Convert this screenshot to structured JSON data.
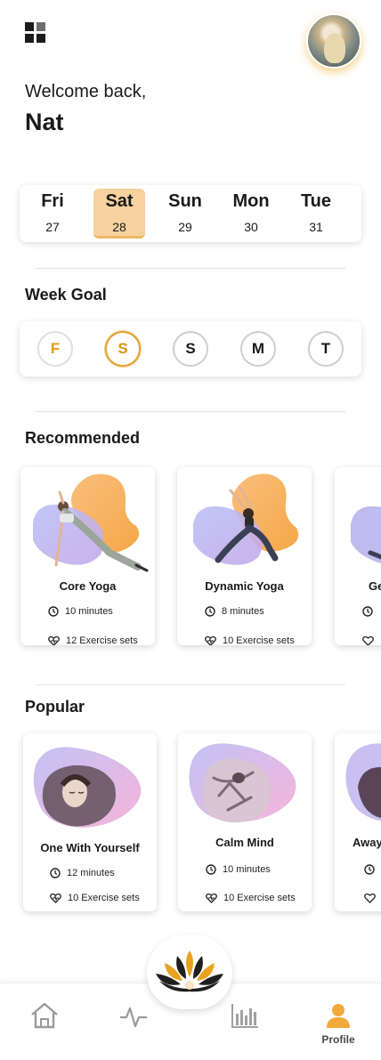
{
  "header": {
    "menu_icon": "grid-menu-icon",
    "avatar_icon": "user-avatar"
  },
  "greeting": {
    "welcome": "Welcome back,",
    "name": "Nat"
  },
  "calendar": {
    "days": [
      {
        "name": "Fri",
        "date": "27",
        "active": false
      },
      {
        "name": "Sat",
        "date": "28",
        "active": true
      },
      {
        "name": "Sun",
        "date": "29",
        "active": false
      },
      {
        "name": "Mon",
        "date": "30",
        "active": false
      },
      {
        "name": "Tue",
        "date": "31",
        "active": false
      }
    ]
  },
  "week_goal": {
    "title": "Week Goal",
    "days": [
      {
        "letter": "F",
        "state": "done"
      },
      {
        "letter": "S",
        "state": "today"
      },
      {
        "letter": "S",
        "state": "upcoming"
      },
      {
        "letter": "M",
        "state": "upcoming"
      },
      {
        "letter": "T",
        "state": "upcoming"
      }
    ]
  },
  "recommended": {
    "title": "Recommended",
    "cards": [
      {
        "title": "Core Yoga",
        "duration": "10 minutes",
        "sets": "12 Exercise sets"
      },
      {
        "title": "Dynamic Yoga",
        "duration": "8 minutes",
        "sets": "10 Exercise sets"
      },
      {
        "title": "Ge",
        "duration": "",
        "sets": ""
      }
    ]
  },
  "popular": {
    "title": "Popular",
    "cards": [
      {
        "title": "One With Yourself",
        "duration": "12 minutes",
        "sets": "10 Exercise sets"
      },
      {
        "title": "Calm Mind",
        "duration": "10 minutes",
        "sets": "10 Exercise sets"
      },
      {
        "title": "Away",
        "duration": "",
        "sets": ""
      }
    ]
  },
  "tabbar": {
    "items": [
      {
        "icon": "home-icon",
        "label": ""
      },
      {
        "icon": "activity-icon",
        "label": ""
      },
      {
        "icon": "lotus-icon",
        "label": ""
      },
      {
        "icon": "bar-chart-icon",
        "label": ""
      },
      {
        "icon": "profile-icon",
        "label": "Profile"
      }
    ]
  },
  "colors": {
    "accent": "#F0A93A",
    "accent_light": "#F6D29F",
    "blob_purple": "#B9B3EE",
    "blob_pink": "#F6B8D8"
  }
}
